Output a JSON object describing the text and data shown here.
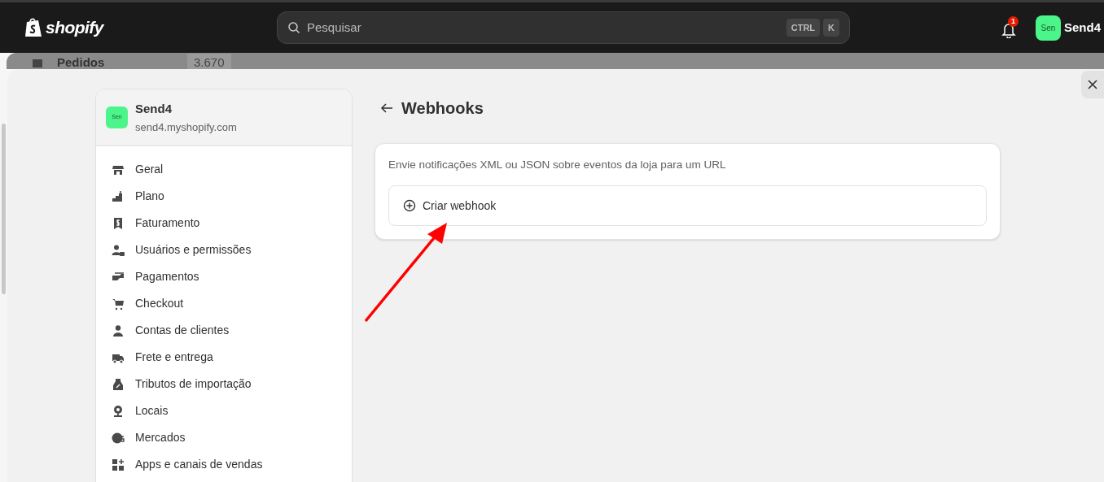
{
  "topbar": {
    "brand": "shopify",
    "search": {
      "placeholder": "Pesquisar",
      "keys": [
        "CTRL",
        "K"
      ]
    },
    "notification_count": "1",
    "store_avatar": "Sen",
    "store_name": "Send4"
  },
  "background_nav": {
    "label": "Pedidos",
    "count": "3.670"
  },
  "sidebar": {
    "store": {
      "avatar": "Sen",
      "name": "Send4",
      "domain": "send4.myshopify.com"
    },
    "items": [
      {
        "label": "Geral"
      },
      {
        "label": "Plano"
      },
      {
        "label": "Faturamento"
      },
      {
        "label": "Usuários e permissões"
      },
      {
        "label": "Pagamentos"
      },
      {
        "label": "Checkout"
      },
      {
        "label": "Contas de clientes"
      },
      {
        "label": "Frete e entrega"
      },
      {
        "label": "Tributos de importação"
      },
      {
        "label": "Locais"
      },
      {
        "label": "Mercados"
      },
      {
        "label": "Apps e canais de vendas"
      }
    ]
  },
  "page": {
    "title": "Webhooks",
    "description": "Envie notificações XML ou JSON sobre eventos da loja para um URL",
    "create_button": "Criar webhook"
  }
}
